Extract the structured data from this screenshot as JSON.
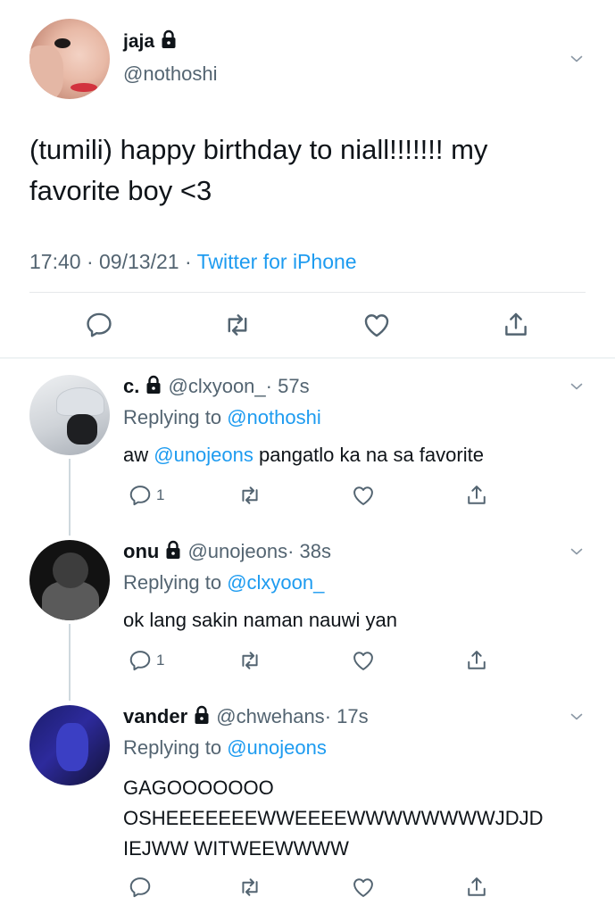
{
  "tweet": {
    "name": "jaja",
    "handle": "@nothoshi",
    "text_line1": "(tumili) happy birthday to niall!!!!!!! my",
    "text_line2": "favorite boy <3",
    "time": "17:40",
    "date": "09/13/21",
    "source": "Twitter for iPhone",
    "sep": "·"
  },
  "replies": [
    {
      "name": "c.",
      "handle": "@clxyoon_",
      "age": "· 57s",
      "replying_prefix": "Replying to",
      "replying_to": "@nothoshi",
      "text_pre": "aw ",
      "mention": "@unojeons",
      "text_post": " pangatlo ka na sa favorite",
      "reply_count": "1"
    },
    {
      "name": "onu",
      "handle": "@unojeons",
      "age": "· 38s",
      "replying_prefix": "Replying to",
      "replying_to": "@clxyoon_",
      "text": "ok lang sakin naman nauwi yan",
      "reply_count": "1"
    },
    {
      "name": "vander",
      "handle": "@chwehans",
      "age": "· 17s",
      "replying_prefix": "Replying to",
      "replying_to": "@unojeons",
      "text_line1": "GAGOOOOOOO",
      "text_line2": "OSHEEEEEEEWWEEEEWWWWWWWWJDJD",
      "text_line3": "IEJWW WITWEEWWWW"
    }
  ],
  "icons": {
    "reply": "reply-icon",
    "retweet": "retweet-icon",
    "like": "heart-icon",
    "share": "share-icon",
    "more": "chevron-down-icon",
    "protected": "lock-icon"
  }
}
